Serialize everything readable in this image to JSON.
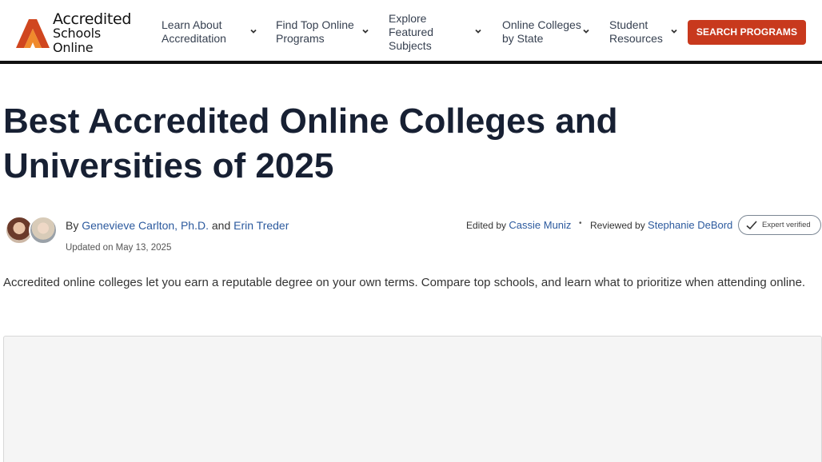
{
  "header": {
    "logo": {
      "line1": "Accredited",
      "line2": "Schools Online"
    },
    "nav": [
      {
        "label": "Learn About Accreditation"
      },
      {
        "label": "Find Top Online Programs"
      },
      {
        "label": "Explore Featured Subjects"
      },
      {
        "label": "Online Colleges by State"
      },
      {
        "label": "Student Resources"
      }
    ],
    "search_label": "SEARCH PROGRAMS"
  },
  "article": {
    "title": "Best Accredited Online Colleges and Universities of 2025",
    "byline": {
      "prefix": "By",
      "author1": "Genevieve Carlton, Ph.D.",
      "and": "and",
      "author2": "Erin Treder"
    },
    "updated": "Updated on May 13, 2025",
    "edited_prefix": "Edited by",
    "editor": "Cassie Muniz",
    "separator": "•",
    "reviewed_prefix": "Reviewed by",
    "reviewer": "Stephanie DeBord",
    "badge": "Expert verified",
    "intro": "Accredited online colleges let you earn a reputable degree on your own terms. Compare top schools, and learn what to prioritize when attending online."
  },
  "colors": {
    "brand_orange": "#c8391d",
    "link": "#2c5a9e",
    "title": "#172033"
  }
}
